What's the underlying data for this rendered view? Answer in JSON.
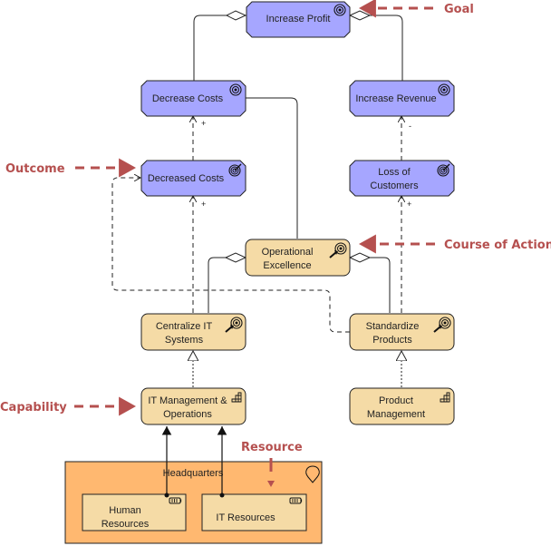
{
  "colors": {
    "goal_fill": "#a6a6ff",
    "course_fill": "#f5dba6",
    "location_fill": "#ffb870",
    "resource_fill": "#f5dba6",
    "annotation": "#b5504f",
    "stroke": "#222222"
  },
  "goals": {
    "increase_profit": "Increase Profit",
    "decrease_costs": "Decrease Costs",
    "increase_revenue": "Increase Revenue"
  },
  "outcomes": {
    "decreased_costs": "Decreased Costs",
    "loss_of_customers": [
      "Loss of",
      "Customers"
    ]
  },
  "courses_of_action": {
    "operational_excellence": [
      "Operational",
      "Excellence"
    ],
    "centralize_it": [
      "Centralize IT",
      "Systems"
    ],
    "standardize_products": [
      "Standardize",
      "Products"
    ]
  },
  "capabilities": {
    "it_management": [
      "IT Management &",
      "Operations"
    ],
    "product_management": [
      "Product",
      "Management"
    ]
  },
  "location": {
    "headquarters": "Headquarters"
  },
  "resources": {
    "human_resources": [
      "Human",
      "Resources"
    ],
    "it_resources": "IT Resources"
  },
  "influence_labels": {
    "decreased_to_decrease": "+",
    "centralize_to_decreased": "+",
    "loss_to_revenue": "-",
    "standardize_to_loss": "+"
  },
  "annotations": {
    "goal": "Goal",
    "outcome": "Outcome",
    "course_of_action": "Course of Action",
    "capability": "Capability",
    "resource": "Resource"
  }
}
